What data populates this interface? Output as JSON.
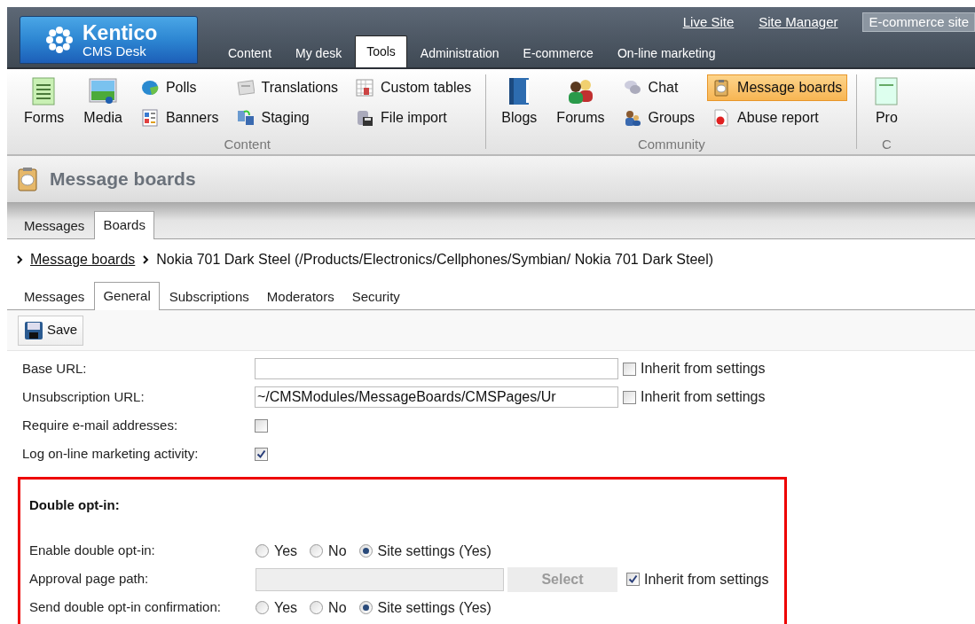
{
  "header": {
    "logo": {
      "name": "Kentico",
      "subtitle": "CMS Desk"
    },
    "links": [
      "Live Site",
      "Site Manager"
    ],
    "site_selector": {
      "value": "E-commerce site"
    },
    "tabs": [
      {
        "label": "Content",
        "selected": false
      },
      {
        "label": "My desk",
        "selected": false
      },
      {
        "label": "Tools",
        "selected": true
      },
      {
        "label": "Administration",
        "selected": false
      },
      {
        "label": "E-commerce",
        "selected": false
      },
      {
        "label": "On-line marketing",
        "selected": false
      }
    ]
  },
  "ribbon": {
    "groups": [
      {
        "label": "Content",
        "columns": [
          [
            {
              "label": "Forms",
              "kind": "large",
              "selected": false
            }
          ],
          [
            {
              "label": "Media",
              "kind": "large",
              "selected": false
            }
          ],
          [
            {
              "label": "Polls",
              "kind": "small",
              "selected": false
            },
            {
              "label": "Banners",
              "kind": "small",
              "selected": false
            }
          ],
          [
            {
              "label": "Translations",
              "kind": "small",
              "selected": false
            },
            {
              "label": "Staging",
              "kind": "small",
              "selected": false
            }
          ],
          [
            {
              "label": "Custom tables",
              "kind": "small",
              "selected": false
            },
            {
              "label": "File import",
              "kind": "small",
              "selected": false
            }
          ]
        ]
      },
      {
        "label": "Community",
        "columns": [
          [
            {
              "label": "Blogs",
              "kind": "large",
              "selected": false
            }
          ],
          [
            {
              "label": "Forums",
              "kind": "large",
              "selected": false
            }
          ],
          [
            {
              "label": "Chat",
              "kind": "small",
              "selected": false
            },
            {
              "label": "Groups",
              "kind": "small",
              "selected": false
            }
          ],
          [
            {
              "label": "Message boards",
              "kind": "small",
              "selected": true
            },
            {
              "label": "Abuse report",
              "kind": "small",
              "selected": false
            }
          ]
        ]
      },
      {
        "label": "C",
        "columns": [
          [
            {
              "label": "Pro",
              "kind": "large",
              "selected": false
            }
          ]
        ]
      }
    ]
  },
  "page": {
    "title": "Message boards",
    "module_tabs": [
      {
        "label": "Messages",
        "selected": false
      },
      {
        "label": "Boards",
        "selected": true
      }
    ],
    "breadcrumb": [
      {
        "label": "Message boards",
        "kind": "link"
      },
      {
        "label": "Nokia 701 Dark Steel (/Products/Electronics/Cellphones/Symbian/ Nokia 701 Dark Steel)",
        "kind": "text"
      }
    ],
    "object_tabs": [
      {
        "label": "Messages",
        "selected": false
      },
      {
        "label": "General",
        "selected": true
      },
      {
        "label": "Subscriptions",
        "selected": false
      },
      {
        "label": "Moderators",
        "selected": false
      },
      {
        "label": "Security",
        "selected": false
      }
    ],
    "save_button": "Save"
  },
  "form": {
    "fields": [
      {
        "label": "Base URL:",
        "kind": "text",
        "inherit": {
          "label": "Inherit from settings",
          "checked": false
        }
      },
      {
        "label": "Unsubscription URL:",
        "kind": "text",
        "value": "~/CMSModules/MessageBoards/CMSPages/Ur",
        "inherit": {
          "label": "Inherit from settings",
          "checked": false
        }
      },
      {
        "label": "Require e-mail addresses:",
        "kind": "checkbox",
        "checked": false
      },
      {
        "label": "Log on-line marketing activity:",
        "kind": "checkbox",
        "checked": true
      }
    ],
    "section": {
      "title": "Double opt-in:",
      "fields": [
        {
          "label": "Enable double opt-in:",
          "kind": "radio",
          "options": [
            {
              "label": "Yes",
              "selected": false
            },
            {
              "label": "No",
              "selected": false
            },
            {
              "label": "Site settings (Yes)",
              "selected": true
            }
          ]
        },
        {
          "label": "Approval page path:",
          "kind": "selector",
          "disabled": true,
          "button": "Select",
          "inherit": {
            "label": "Inherit from settings",
            "checked": true
          }
        },
        {
          "label": "Send double opt-in confirmation:",
          "kind": "radio",
          "options": [
            {
              "label": "Yes",
              "selected": false
            },
            {
              "label": "No",
              "selected": false
            },
            {
              "label": "Site settings (Yes)",
              "selected": true
            }
          ]
        }
      ]
    }
  }
}
